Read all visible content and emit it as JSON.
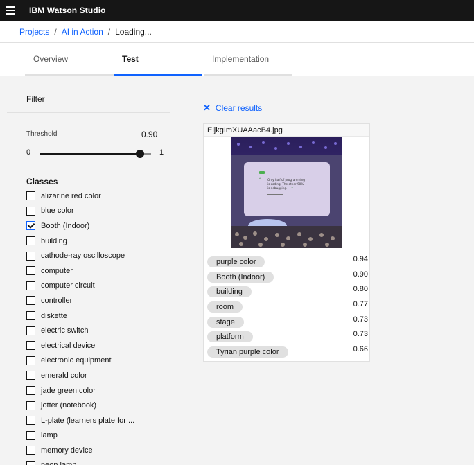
{
  "app": {
    "title": "IBM Watson Studio",
    "menu_icon": "hamburger-menu-icon"
  },
  "breadcrumb": {
    "items": [
      "Projects",
      "AI in Action"
    ],
    "current": "Loading...",
    "separator": "/"
  },
  "tabs": [
    {
      "label": "Overview",
      "active": false
    },
    {
      "label": "Test",
      "active": true
    },
    {
      "label": "Implementation",
      "active": false
    }
  ],
  "filter": {
    "title": "Filter",
    "threshold": {
      "label": "Threshold",
      "value": "0.90",
      "min": "0",
      "max": "1",
      "level": 0.9
    },
    "classes_title": "Classes",
    "classes": [
      {
        "label": "alizarine red color",
        "checked": false
      },
      {
        "label": "blue color",
        "checked": false
      },
      {
        "label": "Booth (Indoor)",
        "checked": true
      },
      {
        "label": "building",
        "checked": false
      },
      {
        "label": "cathode-ray oscilloscope",
        "checked": false
      },
      {
        "label": "computer",
        "checked": false
      },
      {
        "label": "computer circuit",
        "checked": false
      },
      {
        "label": "controller",
        "checked": false
      },
      {
        "label": "diskette",
        "checked": false
      },
      {
        "label": "electric switch",
        "checked": false
      },
      {
        "label": "electrical device",
        "checked": false
      },
      {
        "label": "electronic equipment",
        "checked": false
      },
      {
        "label": "emerald color",
        "checked": false
      },
      {
        "label": "jade green color",
        "checked": false
      },
      {
        "label": "jotter (notebook)",
        "checked": false
      },
      {
        "label": "L-plate (learners plate for ...",
        "checked": false
      },
      {
        "label": "lamp",
        "checked": false
      },
      {
        "label": "memory device",
        "checked": false
      },
      {
        "label": "neon lamp",
        "checked": false
      }
    ]
  },
  "results": {
    "clear_label": "Clear results",
    "card": {
      "filename": "EljkgImXUAAacB4.jpg",
      "image_text": "Only half of programming is coding. The other 90% is debugging.",
      "classes": [
        {
          "label": "purple color",
          "score": "0.94"
        },
        {
          "label": "Booth (Indoor)",
          "score": "0.90"
        },
        {
          "label": "building",
          "score": "0.80"
        },
        {
          "label": "room",
          "score": "0.77"
        },
        {
          "label": "stage",
          "score": "0.73"
        },
        {
          "label": "platform",
          "score": "0.73"
        },
        {
          "label": "Tyrian purple color",
          "score": "0.66"
        }
      ]
    }
  },
  "colors": {
    "accent": "#0f62fe",
    "header_bg": "#161616",
    "page_bg": "#f3f3f3",
    "tag_bg": "#e0e0e0"
  }
}
